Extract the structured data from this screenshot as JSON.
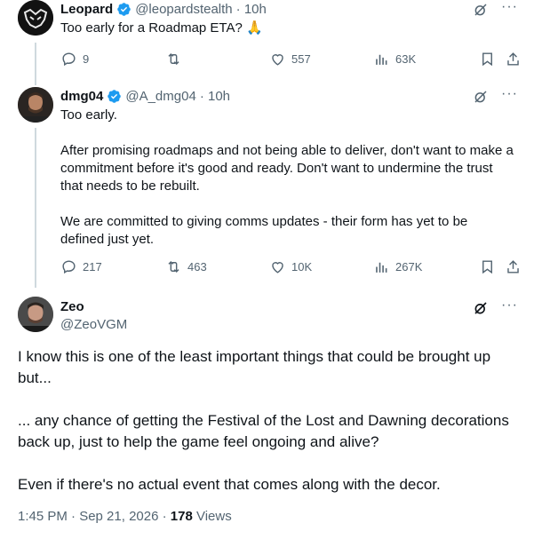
{
  "tweets": [
    {
      "name": "Leopard",
      "handle": "@leopardstealth",
      "time": "· 10h",
      "text": "Too early for a Roadmap ETA? 🙏",
      "replies": "9",
      "reposts": "",
      "likes": "557",
      "views": "63K"
    },
    {
      "name": "dmg04",
      "handle": "@A_dmg04",
      "time": "· 10h",
      "text": "Too early.\n\nAfter promising roadmaps and not being able to deliver, don't want to make a commitment before it's good and ready. Don't want to undermine the trust that needs to be rebuilt.\n\nWe are committed to giving comms updates - their form has yet to be defined just yet.",
      "replies": "217",
      "reposts": "463",
      "likes": "10K",
      "views": "267K"
    }
  ],
  "main": {
    "name": "Zeo",
    "handle": "@ZeoVGM",
    "text": "I know this is one of the least important things that could be brought up but...\n\n... any chance of getting the Festival of the Lost and Dawning decorations back up, just to help the game feel ongoing and alive?\n\nEven if there's no actual event that comes along with the decor.",
    "time": "1:45 PM · Sep 21, 2026 · ",
    "views_count": "178",
    "views_label": " Views"
  },
  "icons": {
    "verified": "verified-badge-icon",
    "grok": "grok-icon",
    "more": "more-icon",
    "reply": "reply-icon",
    "repost": "repost-icon",
    "like": "like-icon",
    "views": "views-icon",
    "bookmark": "bookmark-icon",
    "share": "share-icon"
  },
  "colors": {
    "accent": "#1d9bf0",
    "muted": "#536471",
    "text": "#0f1419"
  }
}
